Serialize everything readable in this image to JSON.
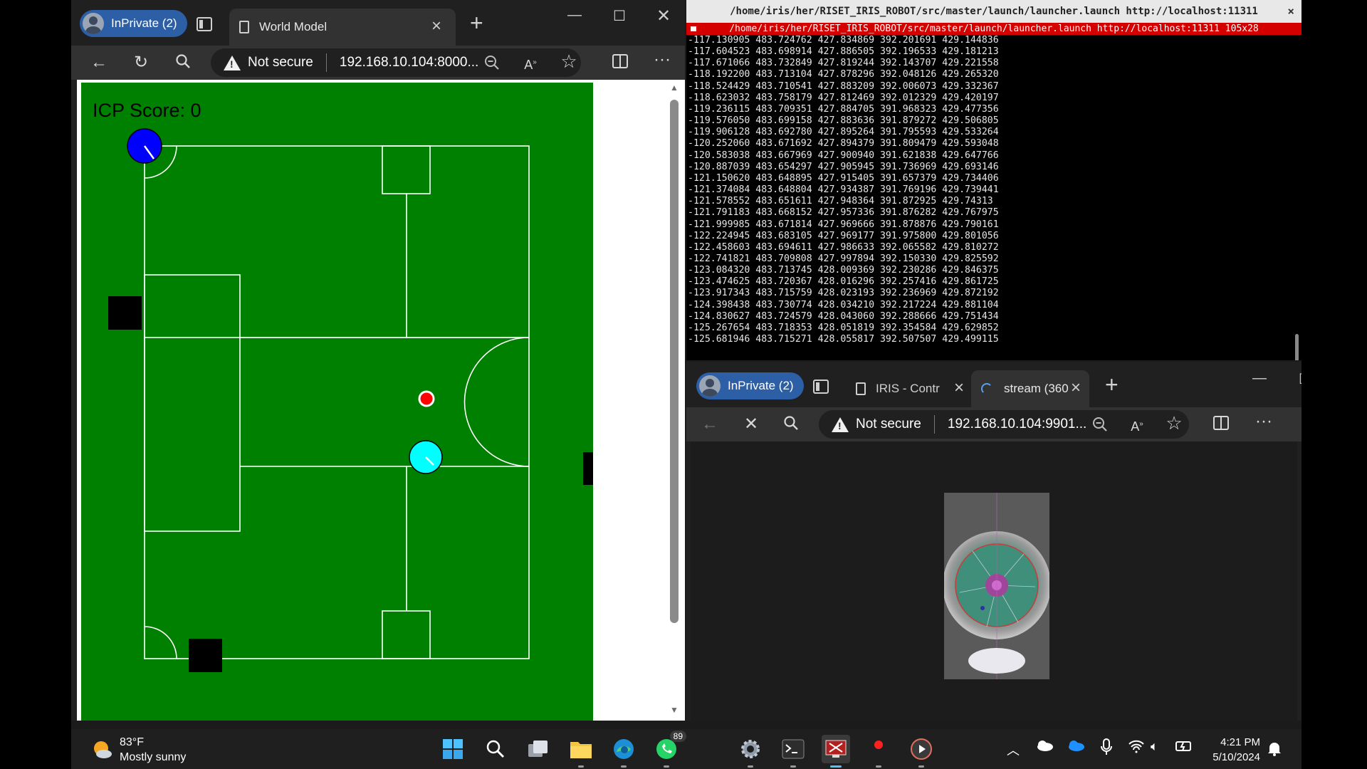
{
  "worldmodel_browser": {
    "profile_label": "InPrivate (2)",
    "tab_title": "World Model",
    "address_warning": "Not secure",
    "address_url": "192.168.10.104:8000...",
    "icp_score_label": "ICP Score: 0"
  },
  "terminal": {
    "title": "/home/iris/her/RISET_IRIS_ROBOT/src/master/launch/launcher.launch http://localhost:11311",
    "subtitle": "/home/iris/her/RISET_IRIS_ROBOT/src/master/launch/launcher.launch http://localhost:11311 105x28",
    "lines": [
      "-117.130905 483.724762 427.834869 392.201691 429.144836",
      "-117.604523 483.698914 427.886505 392.196533 429.181213",
      "-117.671066 483.732849 427.819244 392.143707 429.221558",
      "-118.192200 483.713104 427.878296 392.048126 429.265320",
      "-118.524429 483.710541 427.883209 392.006073 429.332367",
      "-118.623032 483.758179 427.812469 392.012329 429.420197",
      "-119.236115 483.709351 427.884705 391.968323 429.477356",
      "-119.576050 483.699158 427.883636 391.879272 429.506805",
      "-119.906128 483.692780 427.895264 391.795593 429.533264",
      "-120.252060 483.671692 427.894379 391.809479 429.593048",
      "-120.583038 483.667969 427.900940 391.621838 429.647766",
      "-120.887039 483.654297 427.905945 391.736969 429.693146",
      "-121.150620 483.648895 427.915405 391.657379 429.734406",
      "-121.374084 483.648804 427.934387 391.769196 429.739441",
      "-121.578552 483.651611 427.948364 391.872925 429.74313",
      "-121.791183 483.668152 427.957336 391.876282 429.767975",
      "-121.999985 483.671814 427.969666 391.878876 429.790161",
      "-122.224945 483.683105 427.969177 391.975800 429.801056",
      "-122.458603 483.694611 427.986633 392.065582 429.810272",
      "-122.741821 483.709808 427.997894 392.150330 429.825592",
      "-123.084320 483.713745 428.009369 392.230286 429.846375",
      "-123.474625 483.720367 428.016296 392.257416 429.861725",
      "-123.917343 483.715759 428.023193 392.236969 429.872192",
      "-124.398438 483.730774 428.034210 392.217224 429.881104",
      "-124.830627 483.724579 428.043060 392.288666 429.751434",
      "-125.267654 483.718353 428.051819 392.354584 429.629852",
      "-125.681946 483.715271 428.055817 392.507507 429.499115"
    ]
  },
  "stream_browser": {
    "profile_label": "InPrivate (2)",
    "tab1_title": "IRIS - Contr",
    "tab2_title": "stream (360",
    "address_warning": "Not secure",
    "address_url": "192.168.10.104:9901..."
  },
  "taskbar": {
    "weather_temp": "83°F",
    "weather_desc": "Mostly sunny",
    "whatsapp_badge": "89",
    "time": "4:21 PM",
    "date": "5/10/2024"
  },
  "colors": {
    "field": "#008000",
    "robot_self": "#00ffff",
    "robot_other": "#0000ff",
    "ball": "#ff0000",
    "terminal_bar": "#d40000"
  }
}
